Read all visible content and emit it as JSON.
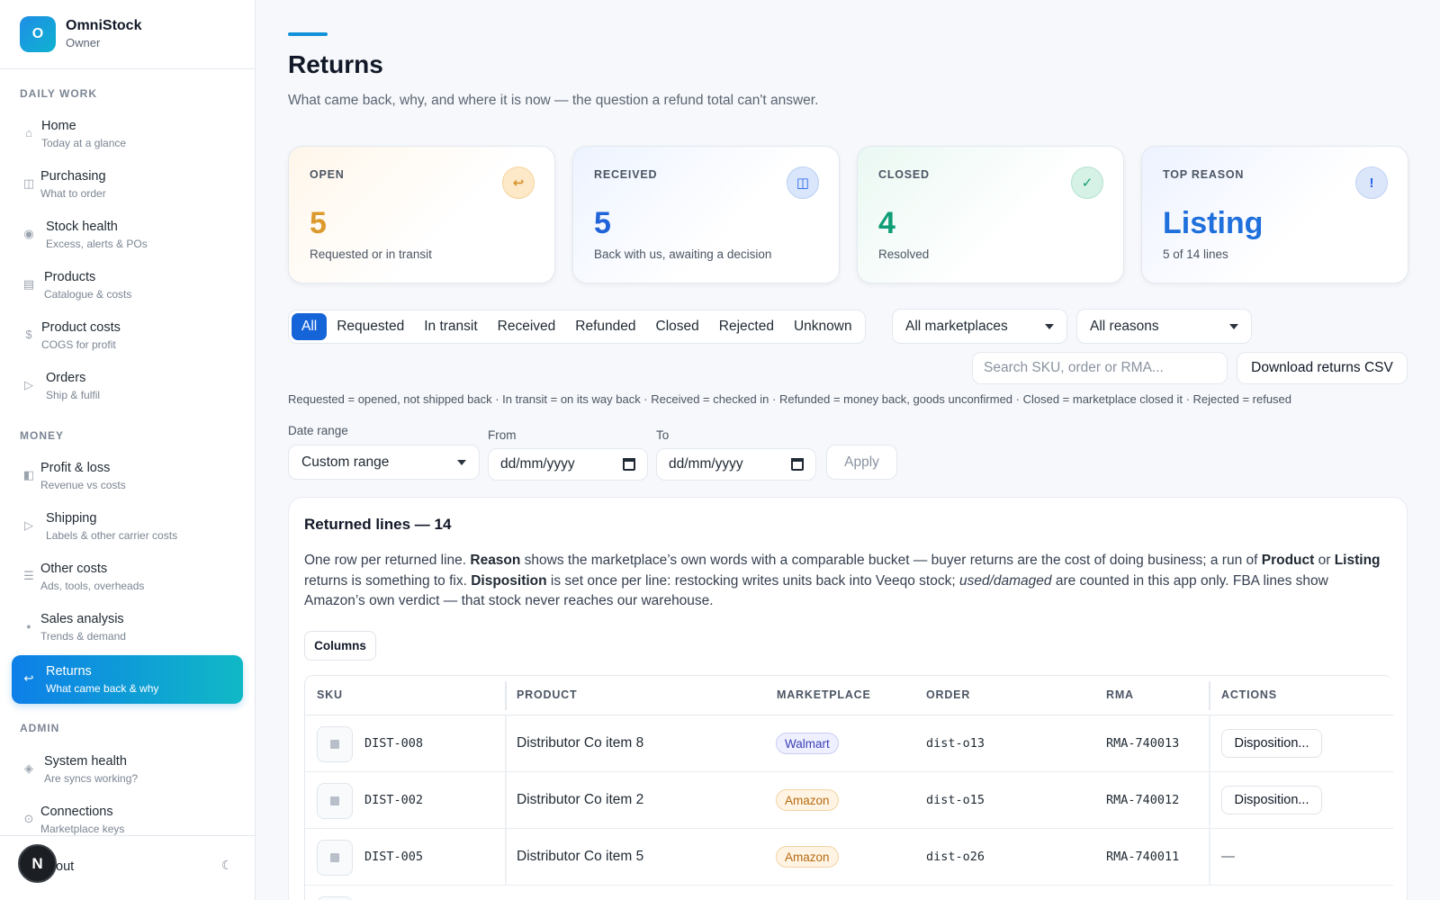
{
  "app": {
    "name": "OmniStock",
    "role": "Owner",
    "logo_letter": "O"
  },
  "sidebar": {
    "sections": [
      "DAILY WORK",
      "MONEY",
      "ADMIN"
    ],
    "items": [
      {
        "label": "Home",
        "sub": "Today at a glance",
        "icon": "home-icon",
        "glyph": "⌂"
      },
      {
        "label": "Purchasing",
        "sub": "What to order",
        "icon": "purchasing-icon",
        "glyph": "◫"
      },
      {
        "label": "Stock health",
        "sub": "Excess, alerts & POs",
        "icon": "stock-health-icon",
        "glyph": "◉"
      },
      {
        "label": "Products",
        "sub": "Catalogue & costs",
        "icon": "products-icon",
        "glyph": "▤"
      },
      {
        "label": "Product costs",
        "sub": "COGS for profit",
        "icon": "dollar-icon",
        "glyph": "$"
      },
      {
        "label": "Orders",
        "sub": "Ship & fulfil",
        "icon": "orders-icon",
        "glyph": "▷"
      },
      {
        "label": "Profit & loss",
        "sub": "Revenue vs costs",
        "icon": "profit-loss-icon",
        "glyph": "◧"
      },
      {
        "label": "Shipping",
        "sub": "Labels & other carrier costs",
        "icon": "shipping-icon",
        "glyph": "▷"
      },
      {
        "label": "Other costs",
        "sub": "Ads, tools, overheads",
        "icon": "list-icon",
        "glyph": "☰"
      },
      {
        "label": "Sales analysis",
        "sub": "Trends & demand",
        "icon": "sales-analysis-icon",
        "glyph": "●"
      },
      {
        "label": "Returns",
        "sub": "What came back & why",
        "icon": "return-icon",
        "glyph": "↩"
      },
      {
        "label": "System health",
        "sub": "Are syncs working?",
        "icon": "system-health-icon",
        "glyph": "◈"
      },
      {
        "label": "Connections",
        "sub": "Marketplace keys",
        "icon": "connections-icon",
        "glyph": "⊙"
      }
    ],
    "footer": {
      "avatar_letter": "N",
      "label": "out",
      "theme_icon": "☾"
    }
  },
  "page": {
    "title": "Returns",
    "subtitle": "What came back, why, and where it is now — the question a refund total can't answer."
  },
  "cards": [
    {
      "label": "OPEN",
      "value": "5",
      "note": "Requested or in transit",
      "icon": "↩"
    },
    {
      "label": "RECEIVED",
      "value": "5",
      "note": "Back with us, awaiting a decision",
      "icon": "◫"
    },
    {
      "label": "CLOSED",
      "value": "4",
      "note": "Resolved",
      "icon": "✓"
    },
    {
      "label": "TOP REASON",
      "value": "Listing",
      "note": "5 of 14 lines",
      "icon": "!"
    }
  ],
  "filters": {
    "statuses": [
      "All",
      "Requested",
      "In transit",
      "Received",
      "Refunded",
      "Closed",
      "Rejected",
      "Unknown"
    ],
    "marketplace": "All marketplaces",
    "reason": "All reasons",
    "search_placeholder": "Search SKU, order or RMA...",
    "download_label": "Download returns CSV",
    "legend": "Requested = opened, not shipped back · In transit = on its way back · Received = checked in · Refunded = money back, goods unconfirmed · Closed = marketplace closed it · Rejected = refused",
    "date_range_label": "Date range",
    "date_range_value": "Custom range",
    "from_label": "From",
    "to_label": "To",
    "date_placeholder": "dd/mm/yyyy",
    "apply_label": "Apply"
  },
  "panel": {
    "title": "Returned lines — 14",
    "desc": {
      "p1": "One row per returned line. ",
      "b1": "Reason",
      "p2": " shows the marketplace’s own words with a comparable bucket — buyer returns are the cost of doing business; a run of ",
      "b2": "Product",
      "p3": " or ",
      "b3": "Listing",
      "p4": " returns is something to fix. ",
      "b4": "Disposition",
      "p5": " is set once per line: restocking writes units back into Veeqo stock; ",
      "i1": "used/damaged",
      "p6": " are counted in this app only. FBA lines show Amazon’s own verdict — that stock never reaches our warehouse."
    },
    "columns_button": "Columns"
  },
  "table": {
    "headers": {
      "sku": "SKU",
      "product": "PRODUCT",
      "marketplace": "MARKETPLACE",
      "order": "ORDER",
      "rma": "RMA",
      "actions": "ACTIONS"
    },
    "rows": [
      {
        "sku": "DIST-008",
        "product": "Distributor Co item 8",
        "marketplace": "Walmart",
        "order": "dist-o13",
        "rma": "RMA-740013",
        "action": "Disposition..."
      },
      {
        "sku": "DIST-002",
        "product": "Distributor Co item 2",
        "marketplace": "Amazon",
        "order": "dist-o15",
        "rma": "RMA-740012",
        "action": "Disposition..."
      },
      {
        "sku": "DIST-005",
        "product": "Distributor Co item 5",
        "marketplace": "Amazon",
        "order": "dist-o26",
        "rma": "RMA-740011",
        "action": "—"
      }
    ]
  }
}
